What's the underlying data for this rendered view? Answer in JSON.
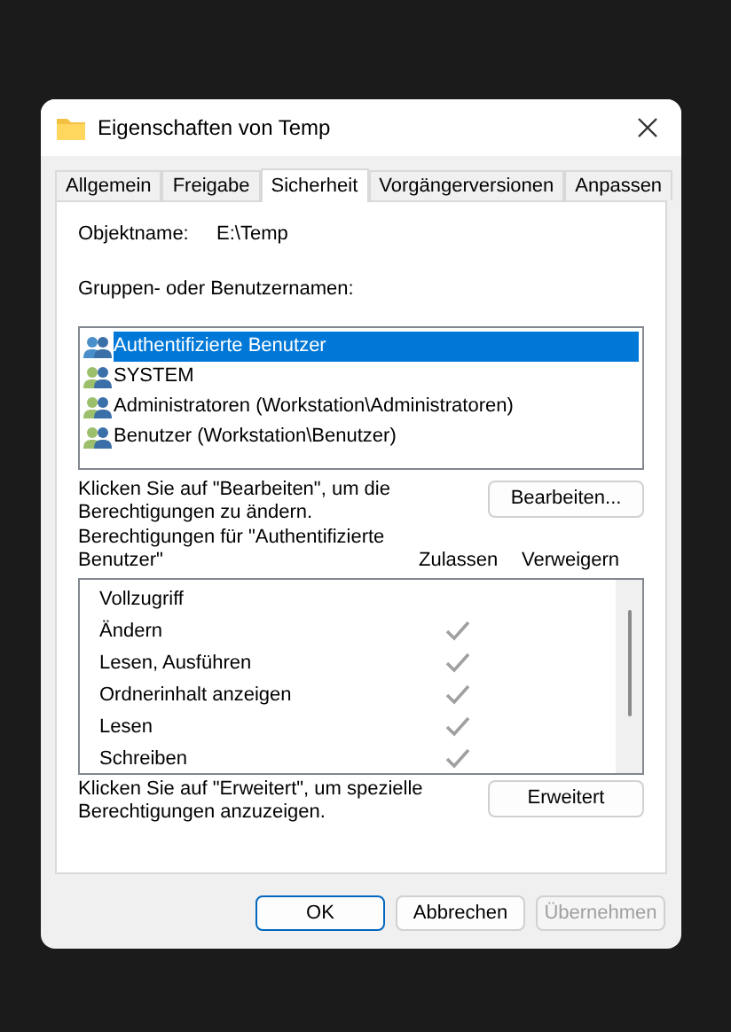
{
  "window": {
    "title": "Eigenschaften von Temp"
  },
  "tabs": [
    {
      "label": "Allgemein",
      "selected": false
    },
    {
      "label": "Freigabe",
      "selected": false
    },
    {
      "label": "Sicherheit",
      "selected": true
    },
    {
      "label": "Vorgängerversionen",
      "selected": false
    },
    {
      "label": "Anpassen",
      "selected": false
    }
  ],
  "object_label": "Objektname:",
  "object_value": "E:\\Temp",
  "groups_label": "Gruppen- oder Benutzernamen:",
  "groups": [
    {
      "name": "Authentifizierte Benutzer",
      "selected": true
    },
    {
      "name": "SYSTEM",
      "selected": false
    },
    {
      "name": "Administratoren (Workstation\\Administratoren)",
      "selected": false
    },
    {
      "name": "Benutzer (Workstation\\Benutzer)",
      "selected": false
    }
  ],
  "edit_hint": "Klicken Sie auf \"Bearbeiten\", um die Berechtigungen zu ändern.",
  "edit_button": "Bearbeiten...",
  "permissions_label": "Berechtigungen für \"Authentifizierte Benutzer\"",
  "allow_header": "Zulassen",
  "deny_header": "Verweigern",
  "permissions": [
    {
      "name": "Vollzugriff",
      "allow": false,
      "deny": false
    },
    {
      "name": "Ändern",
      "allow": true,
      "deny": false
    },
    {
      "name": "Lesen, Ausführen",
      "allow": true,
      "deny": false
    },
    {
      "name": "Ordnerinhalt anzeigen",
      "allow": true,
      "deny": false
    },
    {
      "name": "Lesen",
      "allow": true,
      "deny": false
    },
    {
      "name": "Schreiben",
      "allow": true,
      "deny": false
    }
  ],
  "advanced_hint": "Klicken Sie auf \"Erweitert\", um spezielle Berechtigungen anzuzeigen.",
  "advanced_button": "Erweitert",
  "buttons": [
    {
      "label": "OK",
      "kind": "default",
      "disabled": false
    },
    {
      "label": "Abbrechen",
      "kind": "normal",
      "disabled": false
    },
    {
      "label": "Übernehmen",
      "kind": "normal",
      "disabled": true
    }
  ]
}
